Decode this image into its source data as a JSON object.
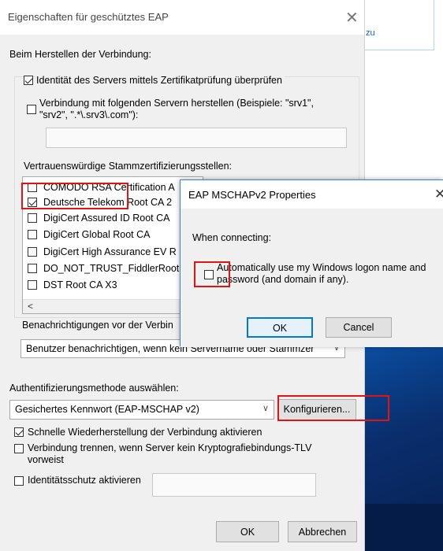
{
  "background": {
    "link_text": "zu"
  },
  "main_dialog": {
    "title": "Eigenschaften für geschütztes EAP",
    "close_glyph": "✕",
    "connection_heading": "Beim Herstellen der Verbindung:",
    "verify_identity_label": "Identität des Servers mittels Zertifikatprüfung überprüfen",
    "connect_servers_label_line1": "Verbindung mit folgenden Servern herstellen (Beispiele: \"srv1\",",
    "connect_servers_label_line2": "\"srv2\", \".*\\.srv3\\.com\"):",
    "server_field_value": "",
    "trusted_ca_heading": "Vertrauenswürdige Stammzertifizierungsstellen:",
    "ca_list": [
      {
        "label": "COMODO RSA Certification A",
        "checked": false
      },
      {
        "label": "Deutsche Telekom Root CA 2",
        "checked": true
      },
      {
        "label": "DigiCert Assured ID Root CA",
        "checked": false
      },
      {
        "label": "DigiCert Global Root CA",
        "checked": false
      },
      {
        "label": "DigiCert High Assurance EV R",
        "checked": false
      },
      {
        "label": "DO_NOT_TRUST_FiddlerRoot",
        "checked": false
      },
      {
        "label": "DST Root CA X3",
        "checked": false
      }
    ],
    "scroll_left_glyph": "<",
    "notifications_heading": "Benachrichtigungen vor der Verbin",
    "notifications_dropdown_value": "Benutzer benachrichtigen, wenn kein Servername oder Stammzer",
    "auth_method_heading": "Authentifizierungsmethode auswählen:",
    "auth_method_value": "Gesichertes Kennwort (EAP-MSCHAP v2)",
    "configure_button": "Konfigurieren...",
    "fast_reconnect_label": "Schnelle Wiederherstellung der Verbindung aktivieren",
    "disconnect_label_line1": "Verbindung trennen, wenn Server kein Kryptografiebindungs-TLV",
    "disconnect_label_line2": "vorweist",
    "identity_privacy_label": "Identitätsschutz aktivieren",
    "identity_field_value": "",
    "ok_button": "OK",
    "cancel_button": "Abbrechen",
    "chevron_glyph": "∨"
  },
  "popup": {
    "title": "EAP MSCHAPv2 Properties",
    "close_glyph": "✕",
    "when_connecting": "When connecting:",
    "auto_logon_line1": "Automatically use my Windows logon name and",
    "auto_logon_line2": "password (and domain if any).",
    "auto_logon_checked": false,
    "ok_button": "OK",
    "cancel_button": "Cancel"
  },
  "colors": {
    "highlight_box": "#e01414",
    "dialog_bg": "#f0f0f0",
    "focus_border": "#0078d7"
  }
}
